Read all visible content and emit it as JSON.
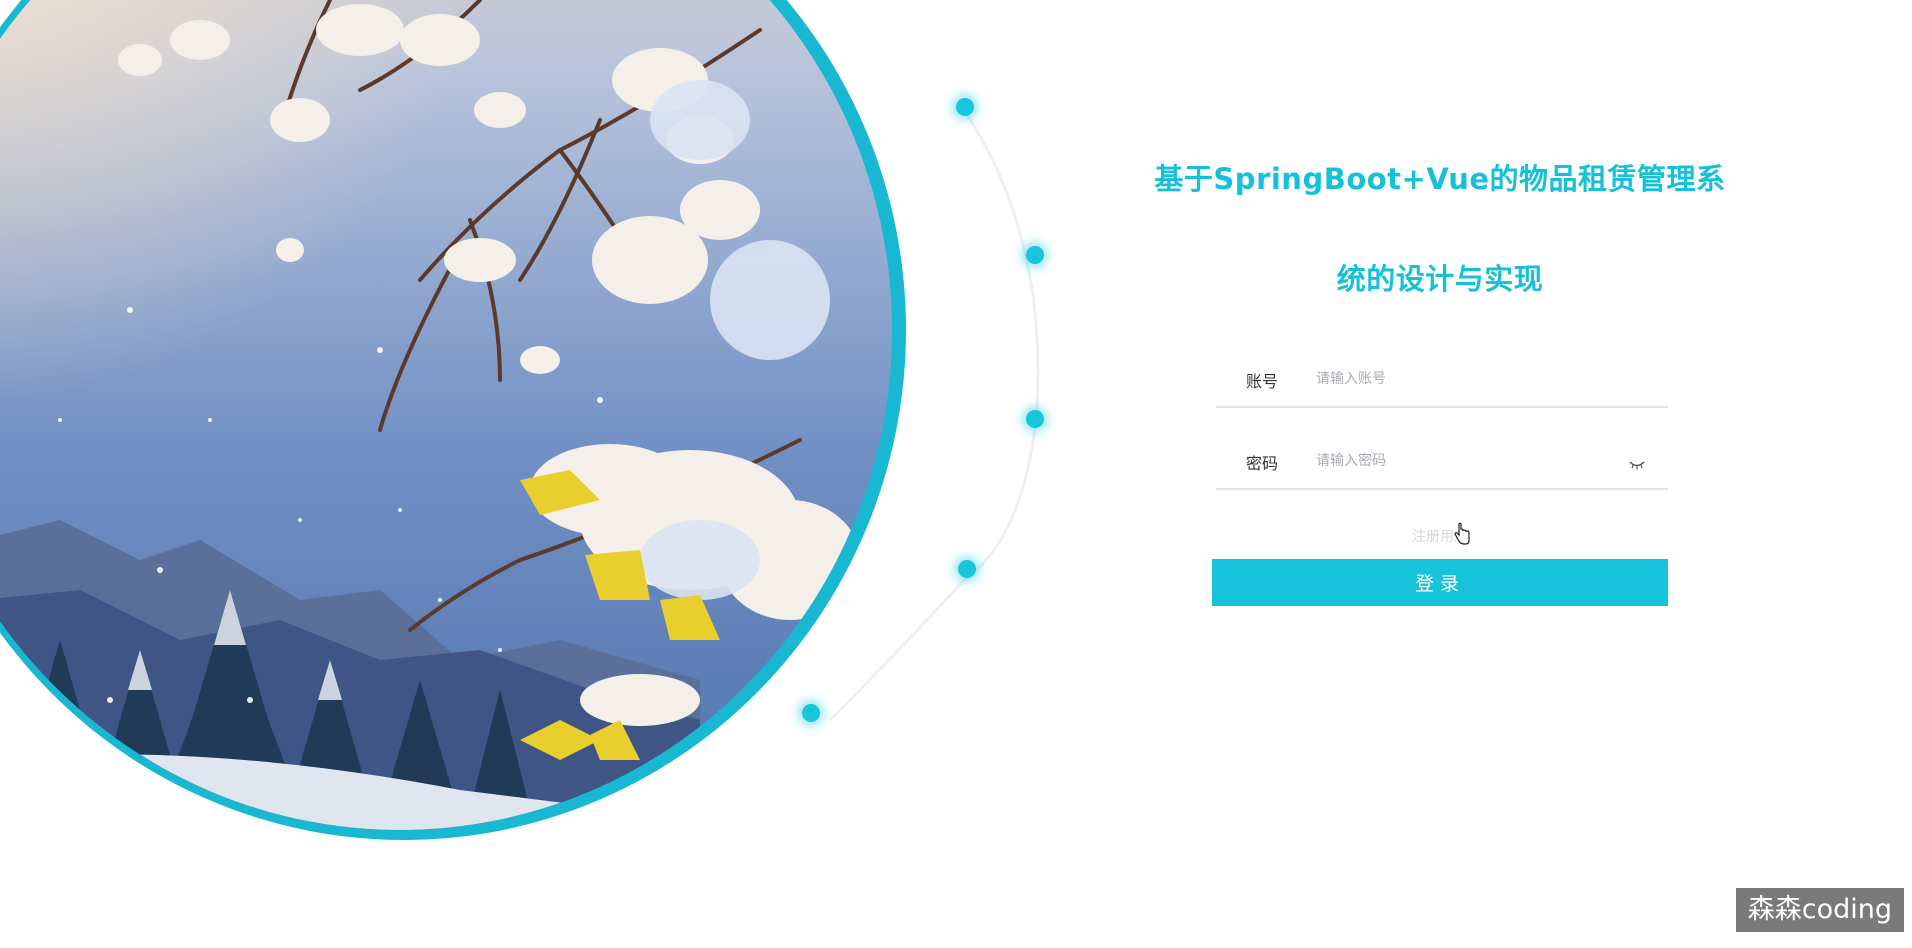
{
  "header": {
    "title_line1": "基于SpringBoot+Vue的物品租赁管理系",
    "title_line2": "统的设计与实现"
  },
  "form": {
    "account_label": "账号",
    "account_placeholder": "请输入账号",
    "password_label": "密码",
    "password_placeholder": "请输入密码",
    "register_link": "注册用户",
    "login_button": "登录"
  },
  "icons": {
    "password_toggle": "eye-closed-icon",
    "cursor": "hand-pointer-icon"
  },
  "watermark": {
    "text": "森森coding"
  },
  "colors": {
    "accent": "#17c3da",
    "title": "#15c1d8",
    "ring": "#1bbad6"
  }
}
